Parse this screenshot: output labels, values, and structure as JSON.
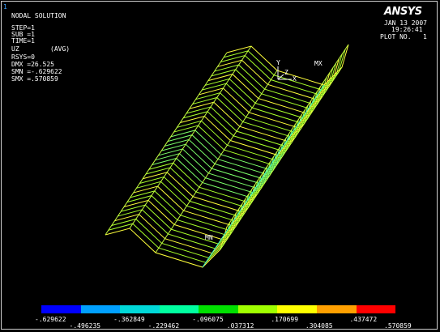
{
  "window_number": "1",
  "header": {
    "title": "NODAL SOLUTION",
    "step": "STEP=1",
    "sub": "SUB =1",
    "time": "TIME=1",
    "variable": "UZ",
    "avg": "(AVG)",
    "rsys": "RSYS=0",
    "dmx": "DMX =26.525",
    "smn": "SMN =-.629622",
    "smx": "SMX =.570859"
  },
  "top_right": {
    "logo": "ANSYS",
    "date": "JAN 13 2007",
    "time": "19:26:41",
    "plot_no": "PLOT NO.   1"
  },
  "triad": {
    "y": "Y",
    "z": "Z",
    "x": "X"
  },
  "markers": {
    "mx": "MX",
    "mn": "MN"
  },
  "legend": {
    "colors": [
      "#0000ff",
      "#00a0ff",
      "#00d8d8",
      "#00ffa0",
      "#00e000",
      "#a0ff00",
      "#ffff00",
      "#ffa000",
      "#ff0000"
    ],
    "values_lower": [
      ".629622",
      ".362849",
      ".096075",
      ".170699",
      ".437472"
    ],
    "values_lower_sign": [
      "-",
      "-",
      "-",
      "",
      ""
    ],
    "values_upper": [
      "-.496235",
      "-.229462",
      ".037312",
      ".304085",
      ".570859"
    ]
  }
}
